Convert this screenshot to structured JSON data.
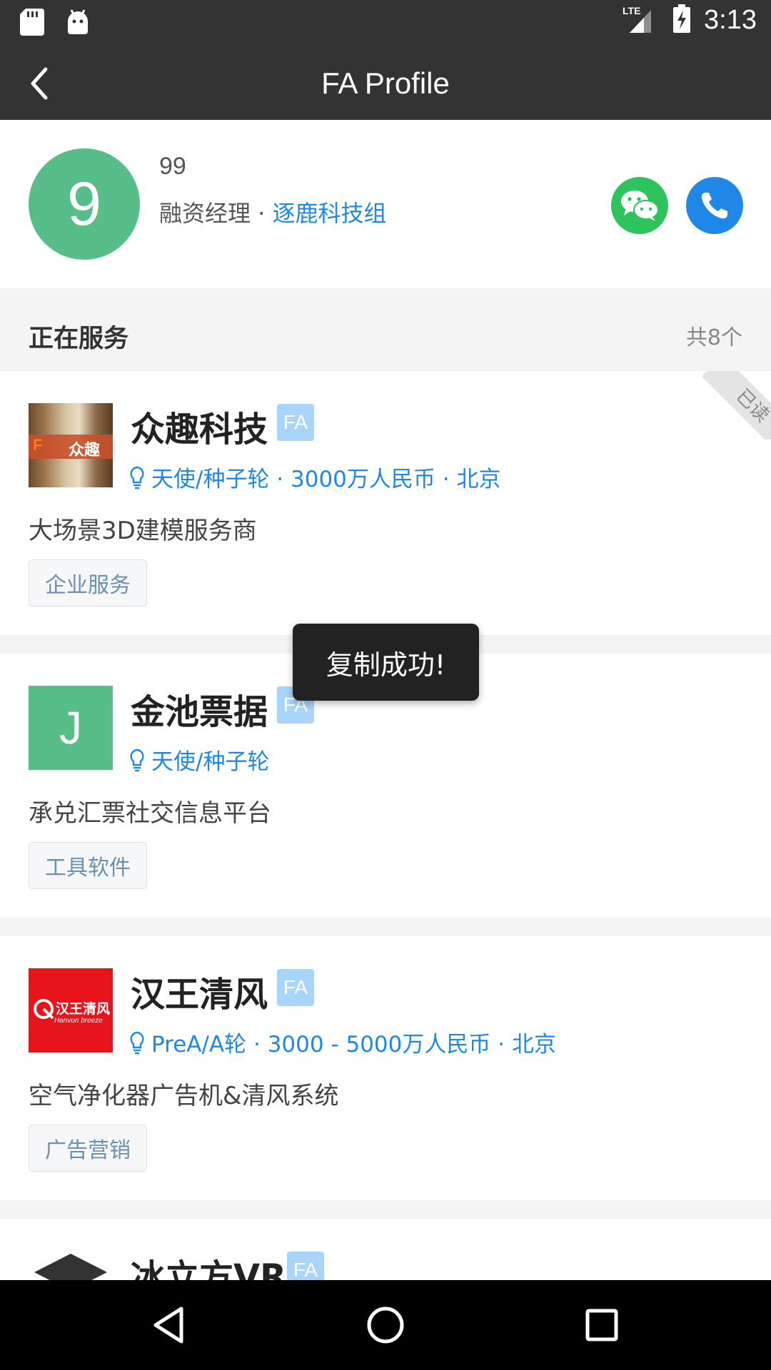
{
  "status_bar": {
    "time": "3:13",
    "network": "LTE"
  },
  "app_bar": {
    "title": "FA Profile"
  },
  "profile": {
    "avatar_letter": "9",
    "name": "99",
    "role": "融资经理 · ",
    "org": "逐鹿科技组"
  },
  "section": {
    "title": "正在服务",
    "count": "共8个"
  },
  "companies": [
    {
      "name": "众趣科技",
      "badge": "FA",
      "meta": "天使/种子轮 · 3000万人民币 · 北京",
      "desc": "大场景3D建模服务商",
      "tag": "企业服务",
      "ribbon": "已读",
      "logo_text": "众趣"
    },
    {
      "name": "金池票据",
      "badge": "FA",
      "meta": "天使/种子轮",
      "desc": "承兑汇票社交信息平台",
      "tag": "工具软件",
      "logo_letter": "J"
    },
    {
      "name": "汉王清风",
      "badge": "FA",
      "meta": "PreA/A轮 · 3000 - 5000万人民币 · 北京",
      "desc": "空气净化器广告机&清风系统",
      "tag": "广告营销",
      "logo_text": "汉王清风",
      "logo_sub": "Hanvon breeze"
    },
    {
      "name": "冰立方VR",
      "badge": "FA"
    }
  ],
  "toast": {
    "text": "复制成功!"
  },
  "colors": {
    "accent": "#1f87e5",
    "green": "#58be89",
    "wechat": "#2dc35d",
    "toolbar": "#333333"
  }
}
